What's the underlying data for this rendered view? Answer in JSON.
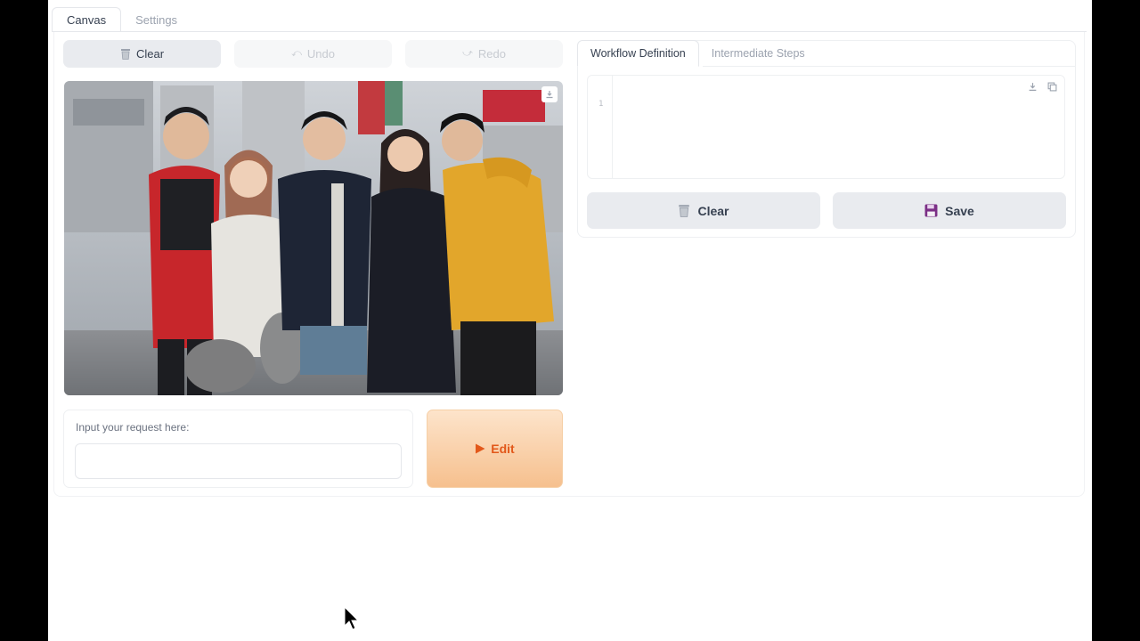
{
  "tabs": [
    {
      "label": "Canvas",
      "active": true
    },
    {
      "label": "Settings",
      "active": false
    }
  ],
  "toolbar": {
    "clear_label": "Clear",
    "undo_label": "Undo",
    "redo_label": "Redo",
    "clear_icon": "trash-icon",
    "undo_icon": "undo-icon",
    "redo_icon": "redo-icon"
  },
  "image": {
    "download_icon": "download-icon"
  },
  "request": {
    "label": "Input your request here:",
    "value": "",
    "placeholder": ""
  },
  "edit_button": {
    "label": "Edit",
    "icon": "play-icon",
    "color": "#e2581a"
  },
  "right_tabs": [
    {
      "label": "Workflow Definition",
      "active": true
    },
    {
      "label": "Intermediate Steps",
      "active": false
    }
  ],
  "code_editor": {
    "line_number": "1",
    "content": "",
    "icons": [
      "download-icon",
      "copy-icon"
    ]
  },
  "actions": {
    "clear_label": "Clear",
    "save_label": "Save",
    "clear_icon": "trash-icon",
    "save_icon": "floppy-disk-icon"
  }
}
